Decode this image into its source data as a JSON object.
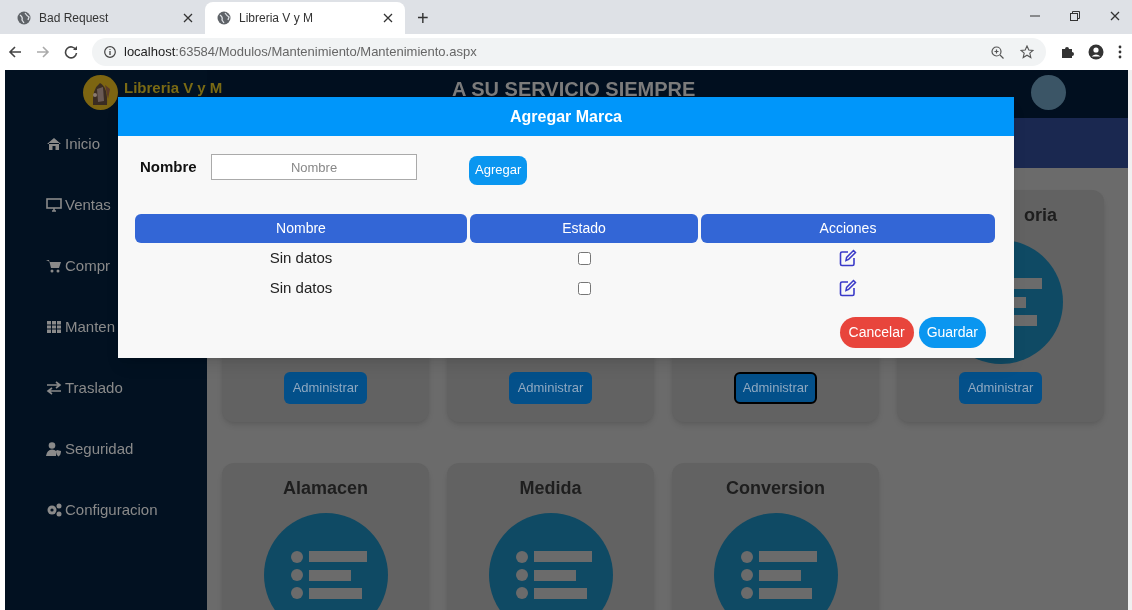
{
  "browser": {
    "tabs": [
      {
        "title": "Bad Request",
        "selected": false
      },
      {
        "title": "Libreria V y M",
        "selected": true
      }
    ],
    "new_tab": "+",
    "url": {
      "host": "localhost",
      "path": ":63584/Modulos/Mantenimiento/Mantenimiento.aspx"
    }
  },
  "header": {
    "brand": "Libreria V y M",
    "slogan": "A SU SERVICIO SIEMPRE"
  },
  "sidebar": {
    "items": [
      {
        "label": "Inicio"
      },
      {
        "label": "Ventas"
      },
      {
        "label": "Compr"
      },
      {
        "label": "Manten"
      },
      {
        "label": "Traslado"
      },
      {
        "label": "Seguridad"
      },
      {
        "label": "Configuracion"
      }
    ]
  },
  "card_rows": [
    {
      "cards": [
        {
          "button": "Administrar",
          "focused": false
        },
        {
          "button": "Administrar",
          "focused": false
        },
        {
          "button": "Administrar",
          "focused": true
        },
        {
          "title": "oria",
          "button": "Administrar",
          "focused": false
        }
      ]
    },
    {
      "cards": [
        {
          "title": "Alamacen"
        },
        {
          "title": "Medida"
        },
        {
          "title": "Conversion"
        }
      ]
    }
  ],
  "modal": {
    "title": "Agregar Marca",
    "form": {
      "label": "Nombre",
      "placeholder": "Nombre",
      "button": "Agregar"
    },
    "table": {
      "columns": [
        "Nombre",
        "Estado",
        "Acciones"
      ],
      "rows": [
        {
          "nombre": "Sin datos",
          "estado": false
        },
        {
          "nombre": "Sin datos",
          "estado": false
        }
      ]
    },
    "buttons": {
      "cancel": "Cancelar",
      "save": "Guardar"
    }
  }
}
